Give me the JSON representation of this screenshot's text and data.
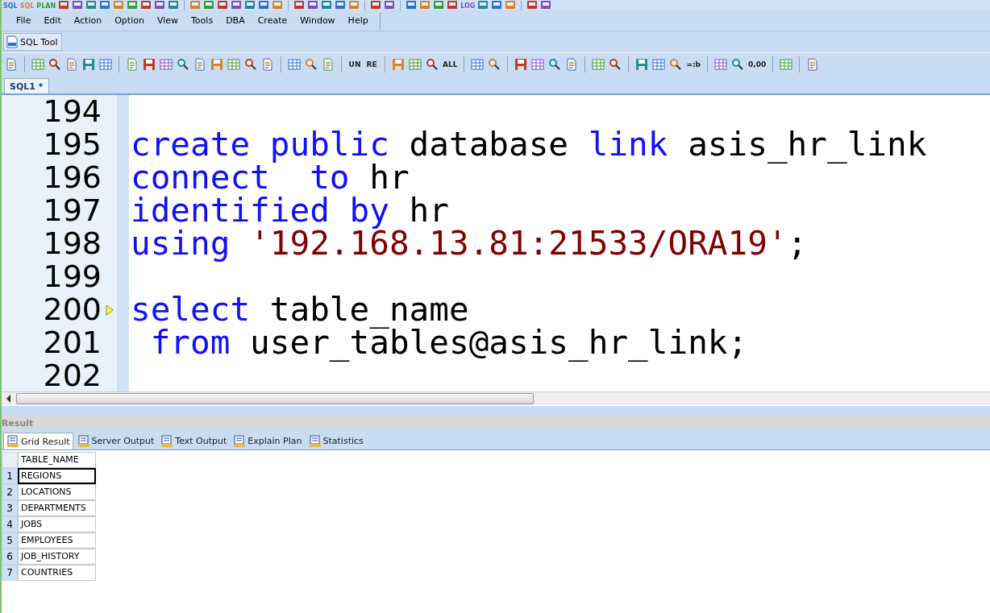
{
  "top_toolbar": [
    {
      "kind": "text",
      "label": "SQL"
    },
    {
      "kind": "text",
      "label": "SQL"
    },
    {
      "kind": "text",
      "label": "PLAN"
    },
    {
      "kind": "tool"
    },
    {
      "kind": "tool"
    },
    {
      "kind": "tool"
    },
    {
      "kind": "tool"
    },
    {
      "kind": "tool"
    },
    {
      "kind": "tool"
    },
    {
      "kind": "tool"
    },
    {
      "kind": "tool"
    },
    {
      "kind": "tool"
    },
    {
      "kind": "sep"
    },
    {
      "kind": "tool"
    },
    {
      "kind": "tool"
    },
    {
      "kind": "tool"
    },
    {
      "kind": "tool"
    },
    {
      "kind": "tool"
    },
    {
      "kind": "tool"
    },
    {
      "kind": "tool"
    },
    {
      "kind": "sep"
    },
    {
      "kind": "tool"
    },
    {
      "kind": "tool"
    },
    {
      "kind": "tool"
    },
    {
      "kind": "tool"
    },
    {
      "kind": "tool"
    },
    {
      "kind": "sep"
    },
    {
      "kind": "tool"
    },
    {
      "kind": "tool"
    },
    {
      "kind": "sep"
    },
    {
      "kind": "tool"
    },
    {
      "kind": "tool"
    },
    {
      "kind": "tool"
    },
    {
      "kind": "tool"
    },
    {
      "kind": "text",
      "label": "LOG"
    },
    {
      "kind": "tool"
    },
    {
      "kind": "tool"
    },
    {
      "kind": "tool"
    },
    {
      "kind": "sep"
    },
    {
      "kind": "tool"
    },
    {
      "kind": "tool"
    }
  ],
  "menu": [
    "File",
    "Edit",
    "Action",
    "Option",
    "View",
    "Tools",
    "DBA",
    "Create",
    "Window",
    "Help"
  ],
  "tool_window": {
    "label": "SQL Tool"
  },
  "toolbar": [
    {
      "kind": "tool"
    },
    {
      "kind": "sep"
    },
    {
      "kind": "tool"
    },
    {
      "kind": "tool"
    },
    {
      "kind": "tool"
    },
    {
      "kind": "tool"
    },
    {
      "kind": "tool"
    },
    {
      "kind": "sep"
    },
    {
      "kind": "tool"
    },
    {
      "kind": "tool"
    },
    {
      "kind": "tool"
    },
    {
      "kind": "tool"
    },
    {
      "kind": "tool"
    },
    {
      "kind": "tool"
    },
    {
      "kind": "tool"
    },
    {
      "kind": "tool"
    },
    {
      "kind": "tool"
    },
    {
      "kind": "sep"
    },
    {
      "kind": "tool"
    },
    {
      "kind": "tool"
    },
    {
      "kind": "tool"
    },
    {
      "kind": "sep"
    },
    {
      "kind": "text",
      "label": "UN"
    },
    {
      "kind": "text",
      "label": "RE"
    },
    {
      "kind": "sep"
    },
    {
      "kind": "tool"
    },
    {
      "kind": "tool"
    },
    {
      "kind": "tool"
    },
    {
      "kind": "text",
      "label": "ALL"
    },
    {
      "kind": "sep"
    },
    {
      "kind": "tool"
    },
    {
      "kind": "tool"
    },
    {
      "kind": "sep"
    },
    {
      "kind": "tool"
    },
    {
      "kind": "tool"
    },
    {
      "kind": "tool"
    },
    {
      "kind": "tool"
    },
    {
      "kind": "sep"
    },
    {
      "kind": "tool"
    },
    {
      "kind": "tool"
    },
    {
      "kind": "sep"
    },
    {
      "kind": "tool"
    },
    {
      "kind": "tool"
    },
    {
      "kind": "tool"
    },
    {
      "kind": "text",
      "label": "=:b"
    },
    {
      "kind": "sep"
    },
    {
      "kind": "tool"
    },
    {
      "kind": "tool"
    },
    {
      "kind": "text",
      "label": "0,00"
    },
    {
      "kind": "sep"
    },
    {
      "kind": "tool"
    },
    {
      "kind": "sep"
    },
    {
      "kind": "tool"
    }
  ],
  "editor_tabs": [
    {
      "label": "SQL1 *",
      "selected": true
    }
  ],
  "code_lines": [
    {
      "number": "194"
    },
    {
      "number": "195",
      "tokens": [
        {
          "kind": "keyword",
          "text": "create public "
        },
        {
          "kind": "plain",
          "text": "database "
        },
        {
          "kind": "keyword",
          "text": "link "
        },
        {
          "kind": "plain",
          "text": "asis_hr_link"
        }
      ]
    },
    {
      "number": "196",
      "tokens": [
        {
          "kind": "keyword",
          "text": "connect  to "
        },
        {
          "kind": "plain",
          "text": "hr"
        }
      ]
    },
    {
      "number": "197",
      "tokens": [
        {
          "kind": "keyword",
          "text": "identified by "
        },
        {
          "kind": "plain",
          "text": "hr"
        }
      ]
    },
    {
      "number": "198",
      "tokens": [
        {
          "kind": "keyword",
          "text": "using "
        },
        {
          "kind": "string",
          "text": "'192.168.13.81:21533/ORA19'"
        },
        {
          "kind": "plain",
          "text": ";"
        }
      ]
    },
    {
      "number": "199"
    },
    {
      "number": "200",
      "current": true,
      "tokens": [
        {
          "kind": "keyword",
          "text": "select "
        },
        {
          "kind": "plain",
          "text": "table_name"
        }
      ]
    },
    {
      "number": "201",
      "tokens": [
        {
          "kind": "keyword",
          "text": " from "
        },
        {
          "kind": "plain",
          "text": "user_tables@asis_hr_link;"
        }
      ]
    },
    {
      "number": "202"
    }
  ],
  "result": {
    "title": "Result",
    "tabs": [
      {
        "label": "Grid Result",
        "selected": true
      },
      {
        "label": "Server Output",
        "selected": false
      },
      {
        "label": "Text Output",
        "selected": false
      },
      {
        "label": "Explain Plan",
        "selected": false
      },
      {
        "label": "Statistics",
        "selected": false
      }
    ],
    "columns": [
      "TABLE_NAME"
    ],
    "rows": [
      {
        "number": "1",
        "value": "REGIONS",
        "selected": true
      },
      {
        "number": "2",
        "value": "LOCATIONS",
        "selected": false
      },
      {
        "number": "3",
        "value": "DEPARTMENTS",
        "selected": false
      },
      {
        "number": "4",
        "value": "JOBS",
        "selected": false
      },
      {
        "number": "5",
        "value": "EMPLOYEES",
        "selected": false
      },
      {
        "number": "6",
        "value": "JOB_HISTORY",
        "selected": false
      },
      {
        "number": "7",
        "value": "COUNTRIES",
        "selected": false
      }
    ]
  }
}
